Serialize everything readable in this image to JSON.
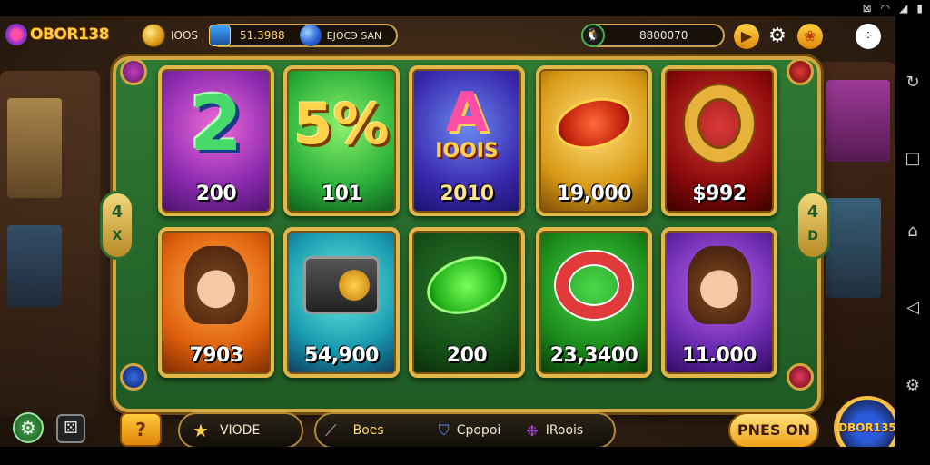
{
  "status_bar": {
    "icons": [
      "⊠",
      "wifi-icon",
      "signal-icon",
      "battery-icon"
    ]
  },
  "header": {
    "logo_text": "OBOR138",
    "gold_label": "IOOS",
    "balance": "51.3988",
    "gem_label": "EJOCЭ SAN",
    "score": "8800070",
    "icons": [
      "coin-icon",
      "treasure-icon",
      "gem-icon",
      "bird-icon",
      "play-icon",
      "gear-icon",
      "paw-icon",
      "more-icon"
    ]
  },
  "board": {
    "left_badge": {
      "line1": "4",
      "line2": "X"
    },
    "right_badge": {
      "line1": "4",
      "line2": "D"
    },
    "tiles": [
      {
        "art": "2",
        "value": "200",
        "theme": "purple"
      },
      {
        "art": "5%",
        "value": "101",
        "theme": "green"
      },
      {
        "art": "A",
        "art_sub": "IOOIS",
        "value": "2010",
        "theme": "blue"
      },
      {
        "art": "chip-red",
        "value": "19,000",
        "theme": "gold"
      },
      {
        "art": "gold-ring",
        "value": "$992",
        "theme": "red"
      },
      {
        "art": "woman",
        "value": "7903",
        "theme": "orange"
      },
      {
        "art": "radio",
        "value": "54,900",
        "theme": "teal"
      },
      {
        "art": "chip-green",
        "value": "200",
        "theme": "darkgreen"
      },
      {
        "art": "lifebuoy",
        "value": "23,3400",
        "theme": "green"
      },
      {
        "art": "woman",
        "value": "11.000",
        "theme": "violet"
      }
    ]
  },
  "footer": {
    "help_label": "?",
    "mode_label": "VIODE",
    "item1_label": "Вoes",
    "item2_label": "Cpopoi",
    "item3_label": "IRoois",
    "spin_label": "PNES ON",
    "badge_label": "DBOR135"
  },
  "colors": {
    "gold": "#d3a73f",
    "felt": "#2f7a33",
    "accent_yellow": "#ffcf3a"
  }
}
